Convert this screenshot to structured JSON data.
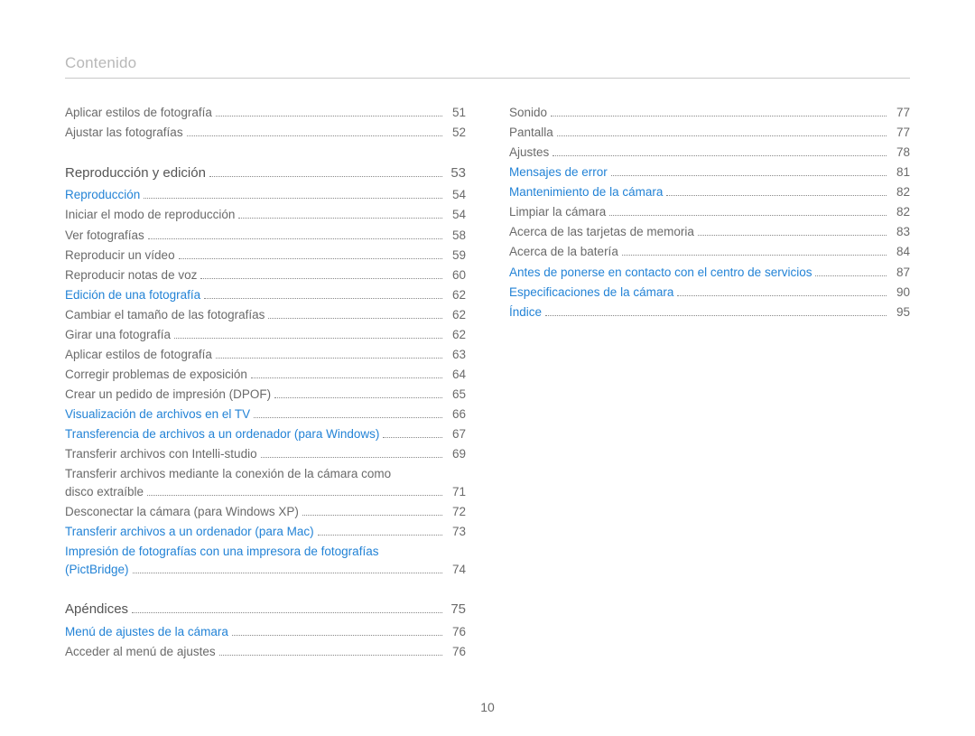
{
  "header": {
    "title": "Contenido"
  },
  "page_number": "10",
  "left": [
    {
      "kind": "plain",
      "label": "Aplicar estilos de fotografía",
      "page": "51"
    },
    {
      "kind": "plain",
      "label": "Ajustar las fotografías",
      "page": "52"
    },
    {
      "kind": "section",
      "label": "Reproducción y edición",
      "page": "53"
    },
    {
      "kind": "link",
      "label": "Reproducción",
      "page": "54"
    },
    {
      "kind": "plain",
      "label": "Iniciar el modo de reproducción",
      "page": "54"
    },
    {
      "kind": "plain",
      "label": "Ver fotografías",
      "page": "58"
    },
    {
      "kind": "plain",
      "label": "Reproducir un vídeo",
      "page": "59"
    },
    {
      "kind": "plain",
      "label": "Reproducir notas de voz",
      "page": "60"
    },
    {
      "kind": "link",
      "label": "Edición de una fotografía",
      "page": "62"
    },
    {
      "kind": "plain",
      "label": "Cambiar el tamaño de las fotografías",
      "page": "62"
    },
    {
      "kind": "plain",
      "label": "Girar una fotografía",
      "page": "62"
    },
    {
      "kind": "plain",
      "label": "Aplicar estilos de fotografía",
      "page": "63"
    },
    {
      "kind": "plain",
      "label": "Corregir problemas de exposición",
      "page": "64"
    },
    {
      "kind": "plain",
      "label": "Crear un pedido de impresión (DPOF)",
      "page": "65"
    },
    {
      "kind": "link",
      "label": "Visualización de archivos en el TV",
      "page": "66"
    },
    {
      "kind": "link",
      "label": "Transferencia de archivos a un ordenador (para Windows)",
      "page": "67"
    },
    {
      "kind": "plain",
      "label": "Transferir archivos con Intelli-studio",
      "page": "69"
    },
    {
      "kind": "wrap-plain",
      "line1": "Transferir archivos mediante la conexión de la cámara como",
      "line2": "disco extraíble",
      "page": "71"
    },
    {
      "kind": "plain",
      "label": "Desconectar la cámara (para Windows XP)",
      "page": "72"
    },
    {
      "kind": "link",
      "label": "Transferir archivos a un ordenador (para Mac)",
      "page": "73"
    },
    {
      "kind": "wrap-link",
      "line1": "Impresión de fotografías con una impresora de fotografías",
      "line2": "(PictBridge)",
      "page": "74"
    },
    {
      "kind": "section",
      "label": "Apéndices",
      "page": "75"
    },
    {
      "kind": "link",
      "label": "Menú de ajustes de la cámara",
      "page": "76"
    },
    {
      "kind": "plain",
      "label": "Acceder al menú de ajustes",
      "page": "76"
    }
  ],
  "right": [
    {
      "kind": "plain",
      "label": "Sonido",
      "page": "77"
    },
    {
      "kind": "plain",
      "label": "Pantalla",
      "page": "77"
    },
    {
      "kind": "plain",
      "label": "Ajustes",
      "page": "78"
    },
    {
      "kind": "link",
      "label": "Mensajes de error",
      "page": "81"
    },
    {
      "kind": "link",
      "label": "Mantenimiento de la cámara",
      "page": "82"
    },
    {
      "kind": "plain",
      "label": "Limpiar la cámara",
      "page": "82"
    },
    {
      "kind": "plain",
      "label": "Acerca de las tarjetas de memoria",
      "page": "83"
    },
    {
      "kind": "plain",
      "label": "Acerca de la batería",
      "page": "84"
    },
    {
      "kind": "link",
      "label": "Antes de ponerse en contacto con el centro de servicios",
      "page": "87"
    },
    {
      "kind": "link",
      "label": "Especificaciones de la cámara",
      "page": "90"
    },
    {
      "kind": "link",
      "label": "Índice",
      "page": "95"
    }
  ]
}
